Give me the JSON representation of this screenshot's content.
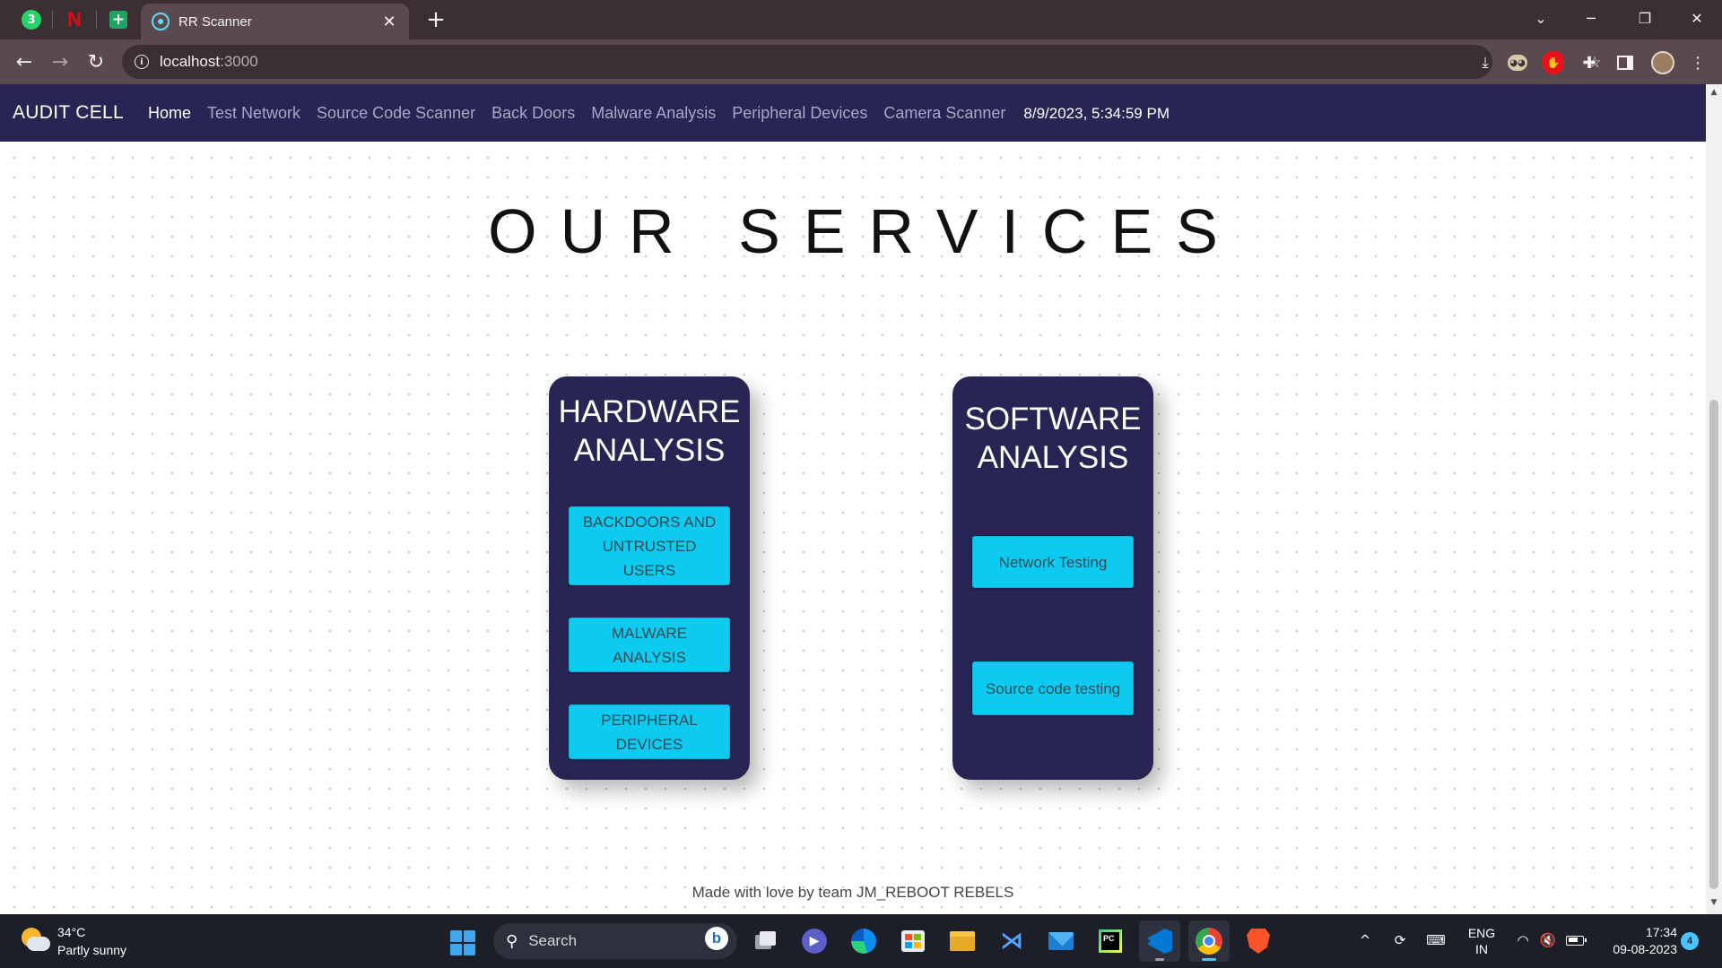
{
  "browser": {
    "pinned_tabs": [
      {
        "icon": "whatsapp-icon",
        "badge": "3"
      },
      {
        "icon": "netflix-icon",
        "glyph": "N"
      },
      {
        "icon": "sheets-icon",
        "glyph": "+"
      }
    ],
    "active_tab": {
      "title": "RR Scanner",
      "close": "✕",
      "icon": "react-icon"
    },
    "new_tab": "+",
    "window_controls": {
      "tab_list": "⌄",
      "minimize": "─",
      "restore": "❐",
      "close": "✕"
    },
    "nav": {
      "back": "←",
      "forward": "→",
      "reload": "↻"
    },
    "address": {
      "host": "localhost",
      "port": ":3000",
      "info": "i"
    },
    "omnibox_icons": {
      "install": "⤓",
      "zoom": "⚲",
      "share": "⇪",
      "bookmark": "☆"
    },
    "toolbar_icons": {
      "ublock": "✋",
      "extensions": "✚",
      "menu": "⋮"
    }
  },
  "navbar": {
    "brand": "AUDIT CELL",
    "links": [
      {
        "label": "Home",
        "active": true
      },
      {
        "label": "Test Network",
        "active": false
      },
      {
        "label": "Source Code Scanner",
        "active": false
      },
      {
        "label": "Back Doors",
        "active": false
      },
      {
        "label": "Malware Analysis",
        "active": false
      },
      {
        "label": "Peripheral Devices",
        "active": false
      },
      {
        "label": "Camera Scanner",
        "active": false
      }
    ],
    "datetime": "8/9/2023, 5:34:59 PM"
  },
  "main": {
    "heading": "OUR SERVICES",
    "cards": [
      {
        "title": "HARDWARE ANALYSIS",
        "buttons": [
          "BACKDOORS AND UNTRUSTED USERS",
          "MALWARE ANALYSIS",
          "PERIPHERAL DEVICES"
        ]
      },
      {
        "title": "SOFTWARE ANALYSIS",
        "buttons": [
          "Network Testing",
          "Source code testing"
        ]
      }
    ],
    "footer": "Made with love by team JM_REBOOT REBELS"
  },
  "scrollbar": {
    "up": "▲",
    "down": "▼"
  },
  "taskbar": {
    "weather": {
      "temp": "34°C",
      "condition": "Partly sunny"
    },
    "search": {
      "label": "Search",
      "glyph": "⚲",
      "bing": "b"
    },
    "apps": [
      "task-view",
      "teams-meet",
      "edge",
      "microsoft-store",
      "file-explorer",
      "visual-studio",
      "mail",
      "pycharm",
      "vscode",
      "chrome",
      "brave"
    ],
    "glyphs": {
      "meet": "▶",
      "vs": "⋊",
      "pycharm": "PC"
    },
    "tray": {
      "chevron": "^",
      "sync": "⟳",
      "keyboard": "⌨",
      "lang_top": "ENG",
      "lang_bottom": "IN",
      "wifi": "◠",
      "volume": "🔇",
      "time": "17:34",
      "date": "09-08-2023",
      "notifications": "4"
    }
  },
  "colors": {
    "navbar": "#262553",
    "card": "#262553",
    "button": "#0dcaf0",
    "taskbar": "#1c1f28"
  }
}
